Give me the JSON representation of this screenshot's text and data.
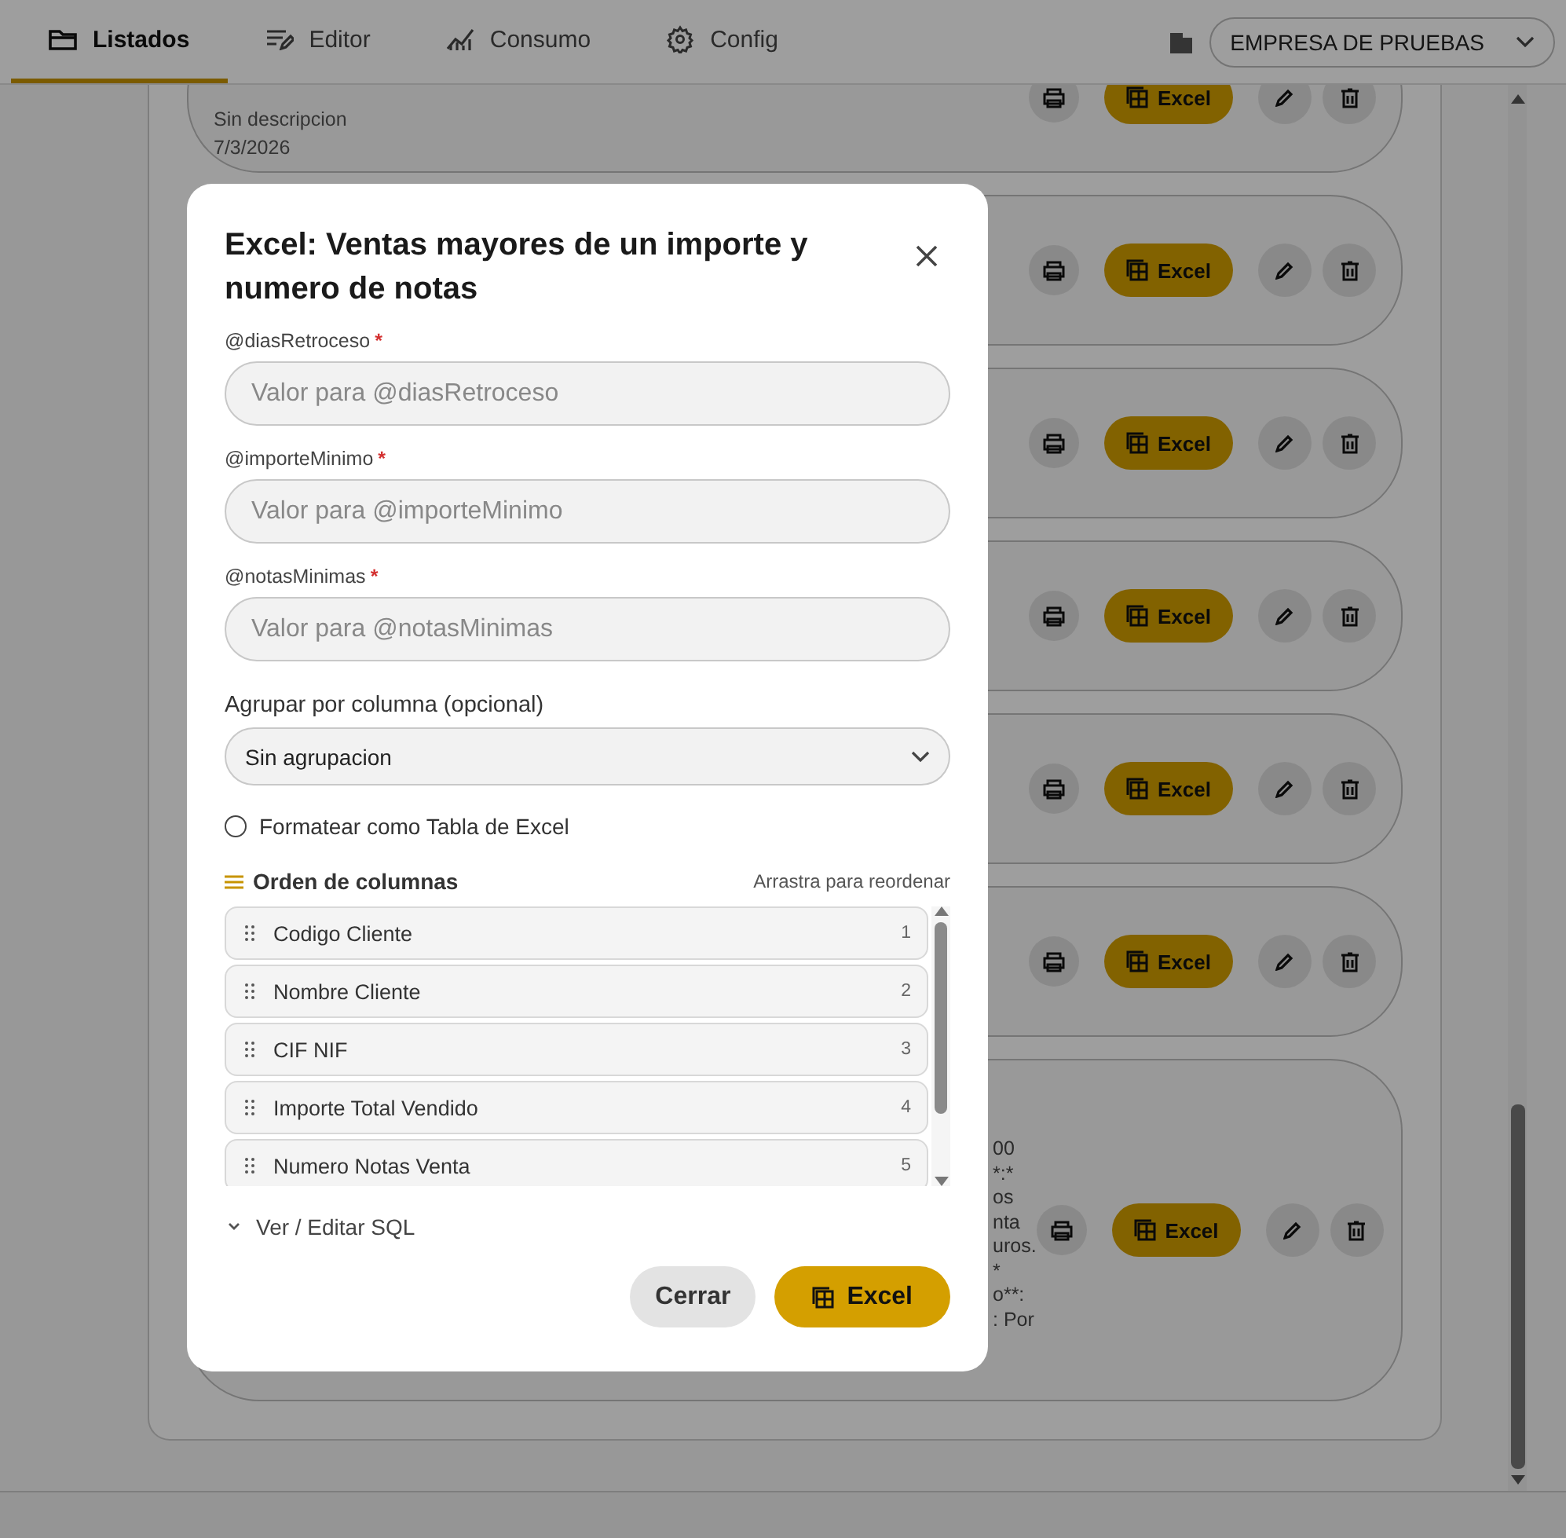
{
  "nav": {
    "tabs": [
      {
        "label": "Listados",
        "kind": "folder",
        "selected": true
      },
      {
        "label": "Editor",
        "kind": "editor",
        "selected": false
      },
      {
        "label": "Consumo",
        "kind": "chart",
        "selected": false
      },
      {
        "label": "Config",
        "kind": "gear",
        "selected": false
      }
    ],
    "company": "EMPRESA DE PRUEBAS"
  },
  "cards": [
    {
      "description": "Sin descripcion",
      "date": "7/3/2026",
      "excel_label": "Excel"
    },
    {
      "excel_label": "Excel"
    },
    {
      "excel_label": "Excel"
    },
    {
      "excel_label": "Excel"
    },
    {
      "excel_label": "Excel"
    },
    {
      "excel_label": "Excel"
    },
    {
      "excel_label": "Excel",
      "fragments": [
        "00",
        "*:*",
        "os",
        "nta",
        "uros. *",
        "o**:",
        ": Por"
      ]
    }
  ],
  "modal": {
    "title": "Excel: Ventas mayores de un importe y numero de notas",
    "fields": [
      {
        "label": "@diasRetroceso",
        "required": true,
        "required_mark": "*",
        "placeholder": "Valor para @diasRetroceso"
      },
      {
        "label": "@importeMinimo",
        "required": true,
        "required_mark": "*",
        "placeholder": "Valor para @importeMinimo"
      },
      {
        "label": "@notasMinimas",
        "required": true,
        "required_mark": "*",
        "placeholder": "Valor para @notasMinimas"
      }
    ],
    "group_label": "Agrupar por columna (opcional)",
    "group_value": "Sin agrupacion",
    "table_format": {
      "label": "Formatear como Tabla de Excel",
      "checked": false
    },
    "columns_title": "Orden de columnas",
    "columns_hint": "Arrastra para reordenar",
    "columns": [
      {
        "name": "Codigo Cliente",
        "number": "1"
      },
      {
        "name": "Nombre Cliente",
        "number": "2"
      },
      {
        "name": "CIF NIF",
        "number": "3"
      },
      {
        "name": "Importe Total Vendido",
        "number": "4"
      },
      {
        "name": "Numero Notas Venta",
        "number": "5"
      }
    ],
    "sql_toggle": {
      "label": "Ver / Editar SQL",
      "expanded": false
    },
    "close_button": "Cerrar",
    "excel_button": "Excel"
  }
}
